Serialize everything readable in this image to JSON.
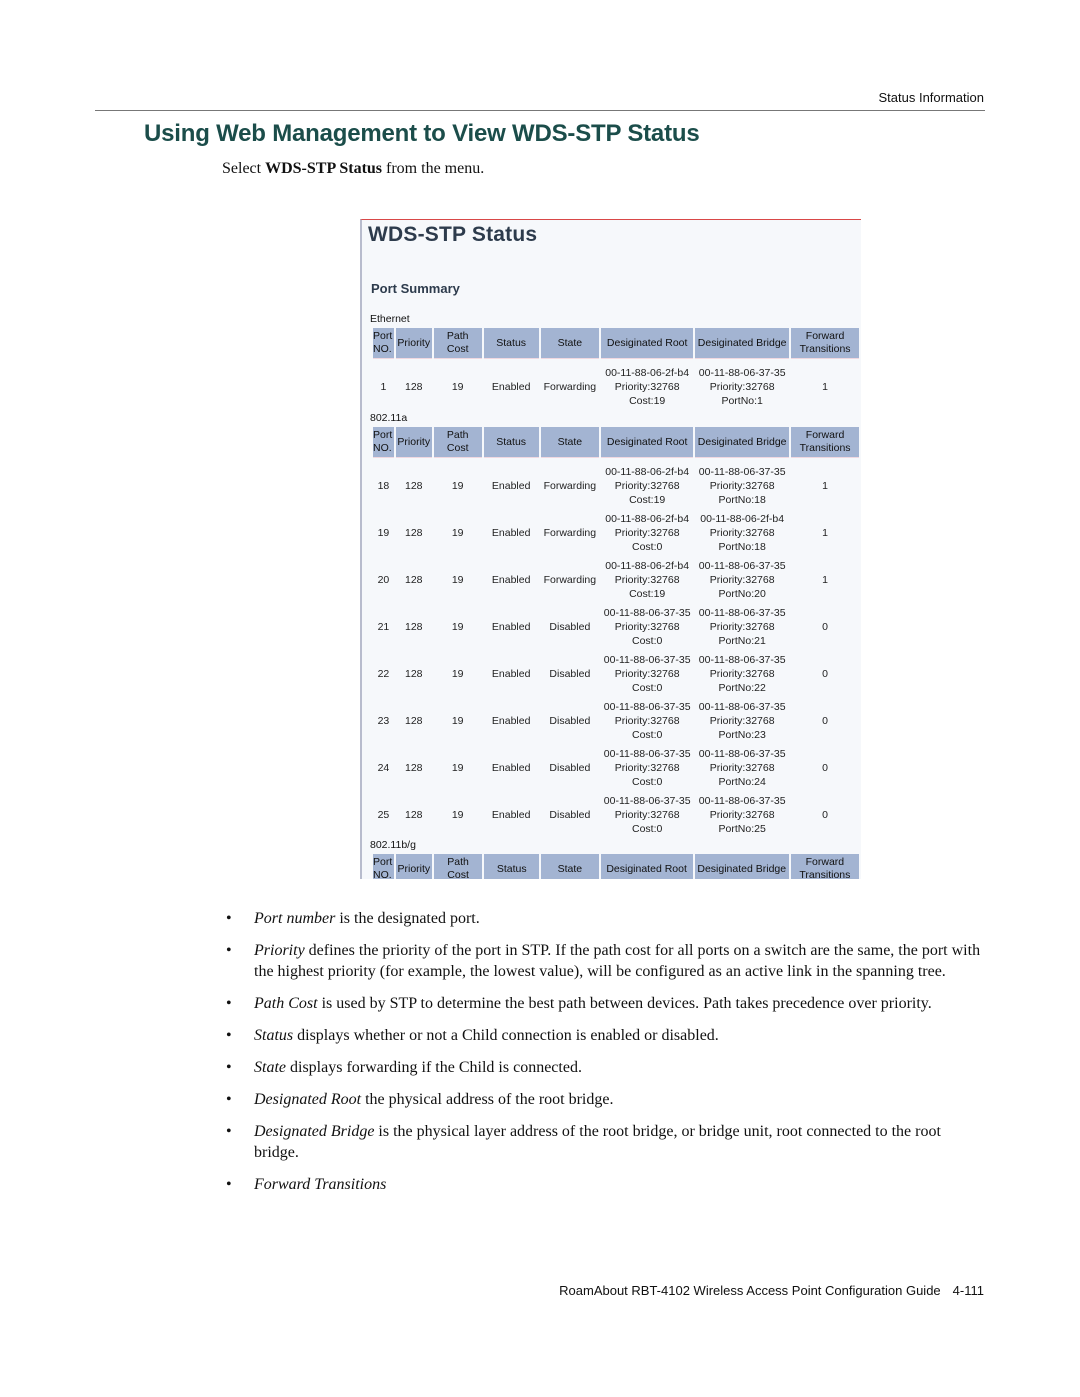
{
  "header": {
    "running_head": "Status Information"
  },
  "section": {
    "title": "Using Web Management to View WDS-STP Status",
    "intro_prefix": "Select ",
    "intro_bold": "WDS-STP Status",
    "intro_suffix": " from the menu."
  },
  "screenshot": {
    "title": "WDS-STP Status",
    "subtitle": "Port Summary",
    "columns": {
      "port_1": "Port",
      "port_2": "NO.",
      "priority": "Priority",
      "path_1": "Path",
      "path_2": "Cost",
      "status": "Status",
      "state": "State",
      "root": "Desiginated Root",
      "bridge": "Desiginated Bridge",
      "fwd_1": "Forward",
      "fwd_2": "Transitions"
    },
    "interfaces": [
      {
        "name": "Ethernet",
        "rows": [
          {
            "port": "1",
            "priority": "128",
            "path_cost": "19",
            "status": "Enabled",
            "state": "Forwarding",
            "root_mac": "00-11-88-06-2f-b4",
            "root_priority": "Priority:32768",
            "root_cost": "Cost:19",
            "bridge_mac": "00-11-88-06-37-35",
            "bridge_priority": "Priority:32768",
            "bridge_port": "PortNo:1",
            "fwd": "1"
          }
        ]
      },
      {
        "name": "802.11a",
        "rows": [
          {
            "port": "18",
            "priority": "128",
            "path_cost": "19",
            "status": "Enabled",
            "state": "Forwarding",
            "root_mac": "00-11-88-06-2f-b4",
            "root_priority": "Priority:32768",
            "root_cost": "Cost:19",
            "bridge_mac": "00-11-88-06-37-35",
            "bridge_priority": "Priority:32768",
            "bridge_port": "PortNo:18",
            "fwd": "1"
          },
          {
            "port": "19",
            "priority": "128",
            "path_cost": "19",
            "status": "Enabled",
            "state": "Forwarding",
            "root_mac": "00-11-88-06-2f-b4",
            "root_priority": "Priority:32768",
            "root_cost": "Cost:0",
            "bridge_mac": "00-11-88-06-2f-b4",
            "bridge_priority": "Priority:32768",
            "bridge_port": "PortNo:18",
            "fwd": "1"
          },
          {
            "port": "20",
            "priority": "128",
            "path_cost": "19",
            "status": "Enabled",
            "state": "Forwarding",
            "root_mac": "00-11-88-06-2f-b4",
            "root_priority": "Priority:32768",
            "root_cost": "Cost:19",
            "bridge_mac": "00-11-88-06-37-35",
            "bridge_priority": "Priority:32768",
            "bridge_port": "PortNo:20",
            "fwd": "1"
          },
          {
            "port": "21",
            "priority": "128",
            "path_cost": "19",
            "status": "Enabled",
            "state": "Disabled",
            "root_mac": "00-11-88-06-37-35",
            "root_priority": "Priority:32768",
            "root_cost": "Cost:0",
            "bridge_mac": "00-11-88-06-37-35",
            "bridge_priority": "Priority:32768",
            "bridge_port": "PortNo:21",
            "fwd": "0"
          },
          {
            "port": "22",
            "priority": "128",
            "path_cost": "19",
            "status": "Enabled",
            "state": "Disabled",
            "root_mac": "00-11-88-06-37-35",
            "root_priority": "Priority:32768",
            "root_cost": "Cost:0",
            "bridge_mac": "00-11-88-06-37-35",
            "bridge_priority": "Priority:32768",
            "bridge_port": "PortNo:22",
            "fwd": "0"
          },
          {
            "port": "23",
            "priority": "128",
            "path_cost": "19",
            "status": "Enabled",
            "state": "Disabled",
            "root_mac": "00-11-88-06-37-35",
            "root_priority": "Priority:32768",
            "root_cost": "Cost:0",
            "bridge_mac": "00-11-88-06-37-35",
            "bridge_priority": "Priority:32768",
            "bridge_port": "PortNo:23",
            "fwd": "0"
          },
          {
            "port": "24",
            "priority": "128",
            "path_cost": "19",
            "status": "Enabled",
            "state": "Disabled",
            "root_mac": "00-11-88-06-37-35",
            "root_priority": "Priority:32768",
            "root_cost": "Cost:0",
            "bridge_mac": "00-11-88-06-37-35",
            "bridge_priority": "Priority:32768",
            "bridge_port": "PortNo:24",
            "fwd": "0"
          },
          {
            "port": "25",
            "priority": "128",
            "path_cost": "19",
            "status": "Enabled",
            "state": "Disabled",
            "root_mac": "00-11-88-06-37-35",
            "root_priority": "Priority:32768",
            "root_cost": "Cost:0",
            "bridge_mac": "00-11-88-06-37-35",
            "bridge_priority": "Priority:32768",
            "bridge_port": "PortNo:25",
            "fwd": "0"
          }
        ]
      },
      {
        "name": "802.11b/g",
        "rows": []
      }
    ]
  },
  "definitions": [
    {
      "term": "Port number",
      "text": " is the designated port."
    },
    {
      "term": "Priority",
      "text": " defines the priority of the port in STP. If the path cost for all ports on a switch are the same, the port with the highest priority (for example, the lowest value), will be configured as an active link in the spanning tree."
    },
    {
      "term": "Path Cost",
      "text": " is used by STP to determine the best path between devices. Path takes precedence over priority."
    },
    {
      "term": "Status",
      "text": " displays whether or not a Child connection is enabled or disabled."
    },
    {
      "term": "State",
      "text": " displays forwarding if the Child is connected."
    },
    {
      "term": "Designated Root",
      "text": " the physical address of the root bridge."
    },
    {
      "term": "Designated Bridge",
      "text": " is the physical layer address of the root bridge, or bridge unit, root connected to the root bridge."
    },
    {
      "term": "Forward Transitions",
      "text": ""
    }
  ],
  "bullet_glyph": "•",
  "footer": {
    "guide_title": "RoamAbout RBT-4102 Wireless Access Point Configuration Guide",
    "page_number": "4-111"
  }
}
